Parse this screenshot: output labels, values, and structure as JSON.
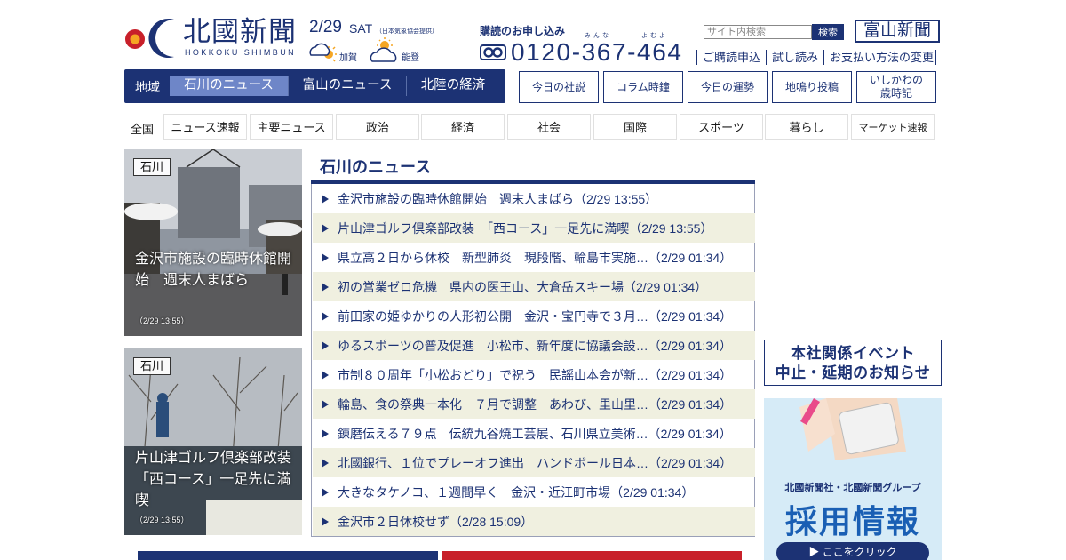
{
  "brand": {
    "logo_text": "北國新聞",
    "logo_sub": "HOKKOKU SHIMBUN",
    "colors": {
      "navy": "#1c3274",
      "active_tab": "#6e86c8",
      "alt_row": "#f0f0e0"
    }
  },
  "date": {
    "date": "2/29",
    "dow": "SAT",
    "weather_source": "（日本気象協会",
    "weather_source_link": "提供",
    "weather_source_end": "）"
  },
  "weather": [
    {
      "label": "加賀",
      "icon": "cloud-sun-icon"
    },
    {
      "label": "能登",
      "icon": "sun-cloud-icon"
    }
  ],
  "subscribe": {
    "title": "購読のお申し込み",
    "ruby_1": "みんな",
    "ruby_2": "よむよ",
    "phone": "0120-367-464"
  },
  "search": {
    "placeholder": "サイト内検索",
    "button": "検索"
  },
  "toyama_button": "富山新聞",
  "top_links": [
    "ご購読申込",
    "試し読み",
    "お支払い方法の変更"
  ],
  "region_nav": {
    "label": "地域",
    "tabs": [
      {
        "label": "石川のニュース",
        "active": true
      },
      {
        "label": "富山のニュース",
        "active": false
      },
      {
        "label": "北陸の経済",
        "active": false
      }
    ]
  },
  "column_buttons": [
    "今日の社説",
    "コラム時鐘",
    "今日の運勢",
    "地鳴り投稿",
    "いしかわの\n歳時記"
  ],
  "categories": {
    "label": "全国",
    "items": [
      "ニュース速報",
      "主要ニュース",
      "政治",
      "経済",
      "社会",
      "国際",
      "スポーツ",
      "暮らし",
      "マーケット速報"
    ]
  },
  "photo_cards": [
    {
      "tag": "石川",
      "caption": "金沢市施設の臨時休館開始　週末人まばら",
      "time": "（2/29 13:55）"
    },
    {
      "tag": "石川",
      "caption": "片山津ゴルフ倶楽部改装　「西コース」一足先に満喫",
      "time": "（2/29 13:55）"
    }
  ],
  "news": {
    "title": "石川のニュース",
    "items": [
      "金沢市施設の臨時休館開始　週末人まばら（2/29 13:55）",
      "片山津ゴルフ倶楽部改装　「西コース」一足先に満喫（2/29 13:55）",
      "県立高２日から休校　新型肺炎　現段階、輪島市実施…（2/29 01:34）",
      "初の営業ゼロ危機　県内の医王山、大倉岳スキー場（2/29 01:34）",
      "前田家の姫ゆかりの人形初公開　金沢・宝円寺で３月…（2/29 01:34）",
      "ゆるスポーツの普及促進　小松市、新年度に協議会設…（2/29 01:34）",
      "市制８０周年「小松おどり」で祝う　民謡山本会が新…（2/29 01:34）",
      "輪島、食の祭典一本化　７月で調整　あわび、里山里…（2/29 01:34）",
      "錬磨伝える７９点　伝統九谷焼工芸展、石川県立美術…（2/29 01:34）",
      "北國銀行、１位でプレーオフ進出　ハンドボール日本…（2/29 01:34）",
      "大きなタケノコ、１週間早く　金沢・近江町市場（2/29 01:34）",
      "金沢市２日休校せず（2/28 15:09）"
    ]
  },
  "event_banner": {
    "line1": "本社関係イベント",
    "line2": "中止・延期のお知らせ"
  },
  "recruit_banner": {
    "sub": "北國新聞社・北國新聞グループ",
    "main": "採用情報",
    "button": "▶ ここをクリック"
  }
}
